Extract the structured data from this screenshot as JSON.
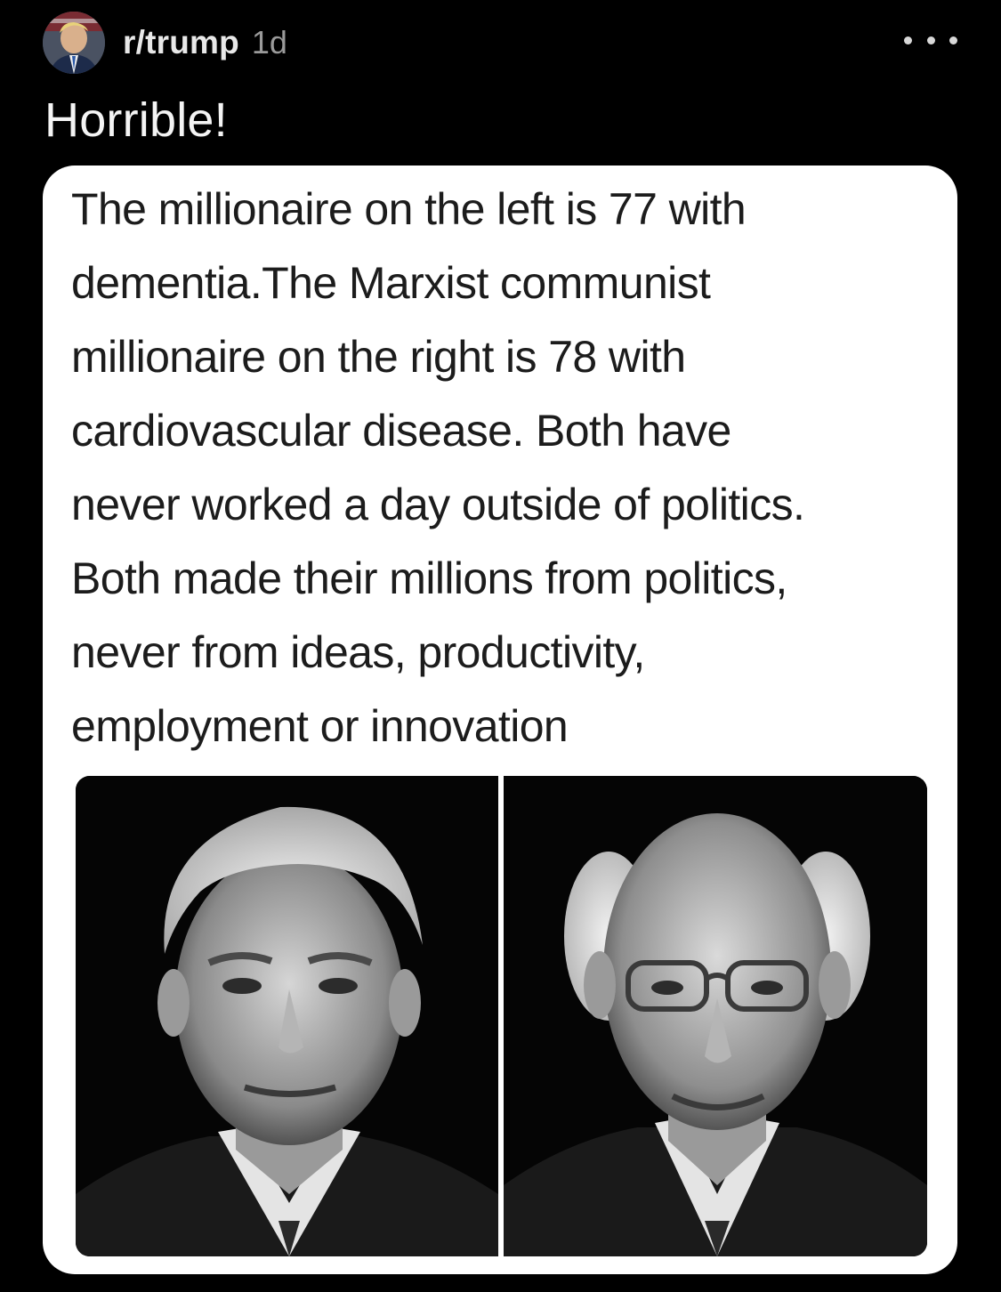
{
  "post": {
    "community": "r/trump",
    "age": "1d",
    "title": "Horrible!"
  },
  "meme": {
    "lines": [
      "The millionaire on the left is 77 with",
      "dementia.The Marxist communist",
      "millionaire on the right is 78 with",
      "cardiovascular disease.  Both have",
      "never worked a day outside of politics.",
      "Both made their millions from politics,",
      "never from ideas, productivity,",
      "employment or innovation"
    ]
  },
  "icons": {
    "more": "more-options-icon"
  },
  "colors": {
    "background": "#000000",
    "card": "#ffffff",
    "meme_text": "#1c1c1c",
    "meta_text": "#9a9a9a"
  }
}
